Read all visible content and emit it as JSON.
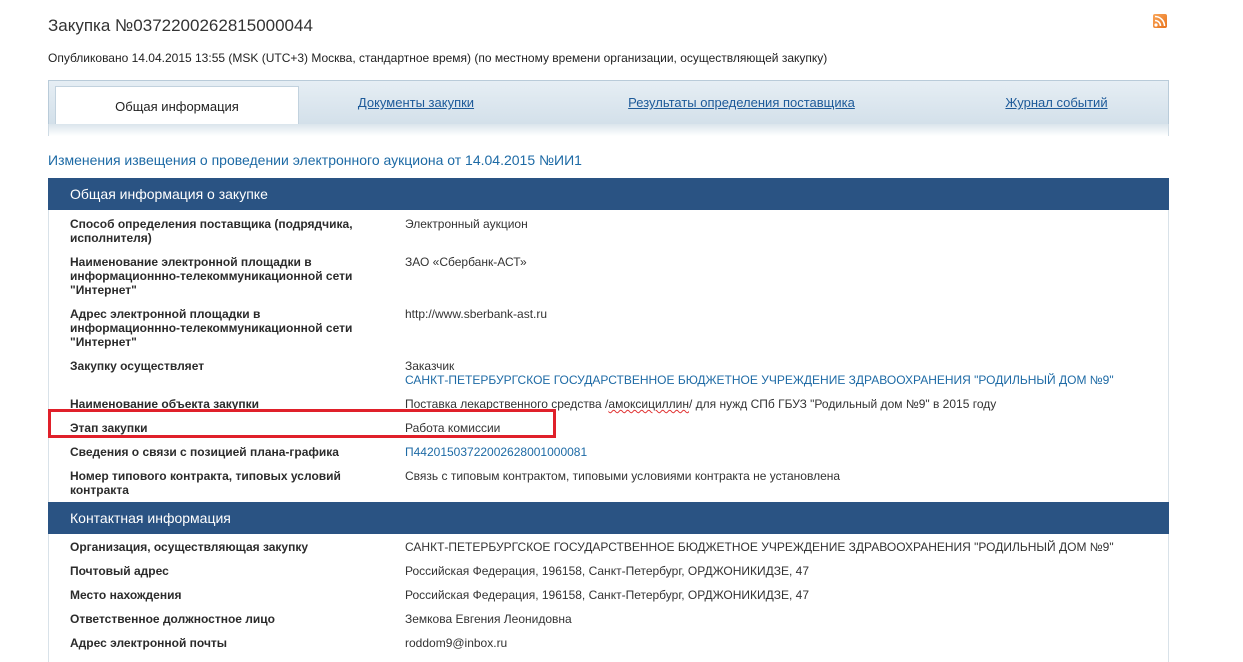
{
  "header": {
    "title": "Закупка №0372200262815000044",
    "published": "Опубликовано 14.04.2015 13:55 (MSK (UTC+3) Москва, стандартное время) (по местному времени организации, осуществляющей закупку)"
  },
  "tabs": [
    {
      "label": "Общая информация",
      "active": true
    },
    {
      "label": "Документы закупки",
      "active": false
    },
    {
      "label": "Результаты определения поставщика",
      "active": false
    },
    {
      "label": "Журнал событий",
      "active": false
    }
  ],
  "changes_link": "Изменения извещения о проведении электронного аукциона от 14.04.2015 №ИИ1",
  "general": {
    "header": "Общая информация о закупке",
    "rows": [
      {
        "label": "Способ определения поставщика (подрядчика, исполнителя)",
        "value": "Электронный аукцион"
      },
      {
        "label": "Наименование электронной площадки в информационнно-телекоммуникационной сети \"Интернет\"",
        "value": "ЗАО «Сбербанк-АСТ»"
      },
      {
        "label": "Адрес электронной площадки в информационнно-телекоммуникационной сети \"Интернет\"",
        "value": "http://www.sberbank-ast.ru"
      },
      {
        "label": "Закупку осуществляет",
        "value": "Заказчик",
        "value_link": "САНКТ-ПЕТЕРБУРГСКОЕ ГОСУДАРСТВЕННОЕ БЮДЖЕТНОЕ УЧРЕЖДЕНИЕ ЗДРАВООХРАНЕНИЯ \"РОДИЛЬНЫЙ ДОМ №9\""
      },
      {
        "label": "Наименование объекта закупки",
        "value_pre": "Поставка лекарственного средства /",
        "value_misspelled": "амоксициллин",
        "value_post": "/ для нужд СПб ГБУЗ \"Родильный дом №9\" в 2015 году"
      },
      {
        "label": "Этап закупки",
        "value": "Работа комиссии"
      },
      {
        "label": "Сведения о связи с позицией плана-графика",
        "value": "П44201503722002628001000081"
      },
      {
        "label": "Номер типового контракта, типовых условий контракта",
        "value": "Связь с типовым контрактом, типовыми условиями контракта не установлена"
      }
    ]
  },
  "contact": {
    "header": "Контактная информация",
    "rows": [
      {
        "label": "Организация, осуществляющая закупку",
        "value": "САНКТ-ПЕТЕРБУРГСКОЕ ГОСУДАРСТВЕННОЕ БЮДЖЕТНОЕ УЧРЕЖДЕНИЕ ЗДРАВООХРАНЕНИЯ \"РОДИЛЬНЫЙ ДОМ №9\""
      },
      {
        "label": "Почтовый адрес",
        "value": "Российская Федерация, 196158, Санкт-Петербург, ОРДЖОНИКИДЗЕ, 47"
      },
      {
        "label": "Место нахождения",
        "value": "Российская Федерация, 196158, Санкт-Петербург, ОРДЖОНИКИДЗЕ, 47"
      },
      {
        "label": "Ответственное должностное лицо",
        "value": "Земкова Евгения Леонидовна"
      },
      {
        "label": "Адрес электронной почты",
        "value": "roddom9@inbox.ru"
      }
    ]
  },
  "icons": {
    "rss": "rss-icon"
  },
  "colors": {
    "section_header": "#2a5383",
    "link": "#1d6aa5",
    "highlight": "#e0202a"
  }
}
